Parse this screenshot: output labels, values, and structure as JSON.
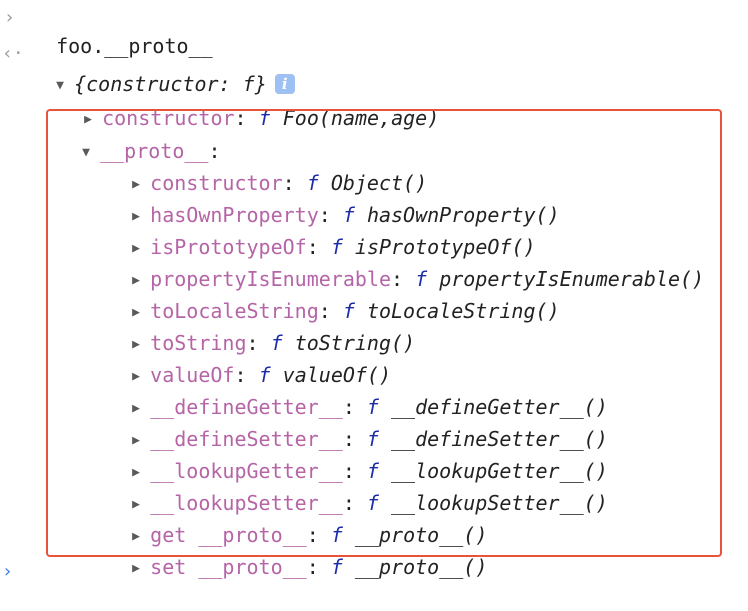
{
  "input": {
    "expression": "foo.__proto__"
  },
  "result": {
    "summary": "{constructor: f}",
    "info_badge": "i",
    "constructor": {
      "key": "constructor",
      "f": "f",
      "value": "Foo(name,age)"
    },
    "proto": {
      "key": "__proto__",
      "items": [
        {
          "key": "constructor",
          "f": "f",
          "value": "Object()"
        },
        {
          "key": "hasOwnProperty",
          "f": "f",
          "value": "hasOwnProperty()"
        },
        {
          "key": "isPrototypeOf",
          "f": "f",
          "value": "isPrototypeOf()"
        },
        {
          "key": "propertyIsEnumerable",
          "f": "f",
          "value": "propertyIsEnumerable()"
        },
        {
          "key": "toLocaleString",
          "f": "f",
          "value": "toLocaleString()"
        },
        {
          "key": "toString",
          "f": "f",
          "value": "toString()"
        },
        {
          "key": "valueOf",
          "f": "f",
          "value": "valueOf()"
        },
        {
          "key": "__defineGetter__",
          "f": "f",
          "value": "__defineGetter__()"
        },
        {
          "key": "__defineSetter__",
          "f": "f",
          "value": "__defineSetter__()"
        },
        {
          "key": "__lookupGetter__",
          "f": "f",
          "value": "__lookupGetter__()"
        },
        {
          "key": "__lookupSetter__",
          "f": "f",
          "value": "__lookupSetter__()"
        },
        {
          "key": "get __proto__",
          "f": "f",
          "value": "__proto__()"
        },
        {
          "key": "set __proto__",
          "f": "f",
          "value": "__proto__()"
        }
      ]
    }
  },
  "colors": {
    "property_key": "#b565a7",
    "function_marker": "#1c2ca8",
    "highlight_border": "#e8533b",
    "info_badge": "#9ec0f2",
    "prompt_arrow": "#3b7ddd"
  }
}
